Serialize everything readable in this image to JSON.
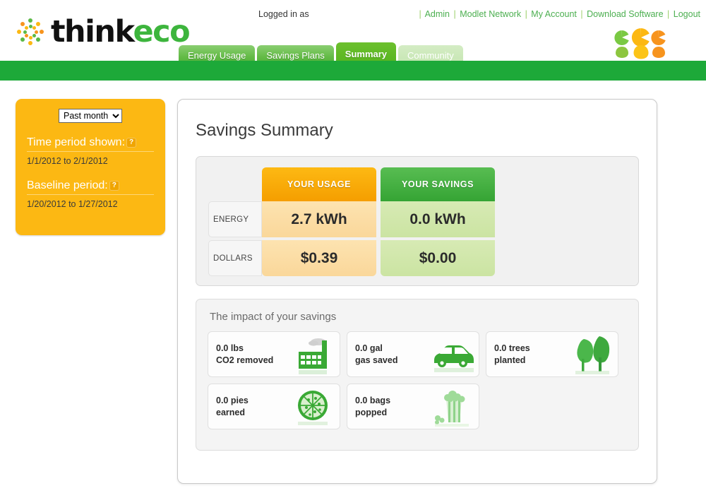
{
  "header": {
    "brand_think": "think",
    "brand_eco": "eco",
    "logged_in_label": "Logged in as",
    "logo_icon": "sunburst-dots-logo",
    "mascots_icon": "three-outlet-mascots",
    "top_links": [
      {
        "label": "Admin"
      },
      {
        "label": "Modlet Network"
      },
      {
        "label": "My Account"
      },
      {
        "label": "Download Software"
      },
      {
        "label": "Logout"
      }
    ],
    "tabs": [
      {
        "label": "Energy Usage",
        "state": "normal"
      },
      {
        "label": "Savings Plans",
        "state": "normal"
      },
      {
        "label": "Summary",
        "state": "active"
      },
      {
        "label": "Community",
        "state": "dim"
      }
    ]
  },
  "sidebar": {
    "period_select": {
      "value": "Past month",
      "options": [
        "Past month"
      ]
    },
    "time_period": {
      "label": "Time period shown:",
      "help_glyph": "?",
      "value": "1/1/2012 to 2/1/2012"
    },
    "baseline_period": {
      "label": "Baseline period:",
      "help_glyph": "?",
      "value": "1/20/2012 to 1/27/2012"
    }
  },
  "main": {
    "page_title": "Savings Summary",
    "summary": {
      "col_usage": "YOUR USAGE",
      "col_savings": "YOUR SAVINGS",
      "rows": [
        {
          "label": "ENERGY",
          "usage": "2.7 kWh",
          "savings": "0.0 kWh"
        },
        {
          "label": "DOLLARS",
          "usage": "$0.39",
          "savings": "$0.00"
        }
      ]
    },
    "impact": {
      "title": "The impact of your savings",
      "items": [
        {
          "line1": "0.0 lbs",
          "line2": "CO2 removed",
          "icon": "factory-icon"
        },
        {
          "line1": "0.0 gal",
          "line2": "gas saved",
          "icon": "car-icon"
        },
        {
          "line1": "0.0 trees",
          "line2": "planted",
          "icon": "trees-icon"
        },
        {
          "line1": "0.0 pies",
          "line2": "earned",
          "icon": "pizza-icon"
        },
        {
          "line1": "0.0 bags",
          "line2": "popped",
          "icon": "popcorn-icon"
        }
      ]
    }
  },
  "colors": {
    "green_bar": "#1da939",
    "sidebar_yellow": "#fcb813",
    "usage_orange": "#f59e00",
    "savings_green": "#35a434",
    "link_green": "#4caf50"
  }
}
